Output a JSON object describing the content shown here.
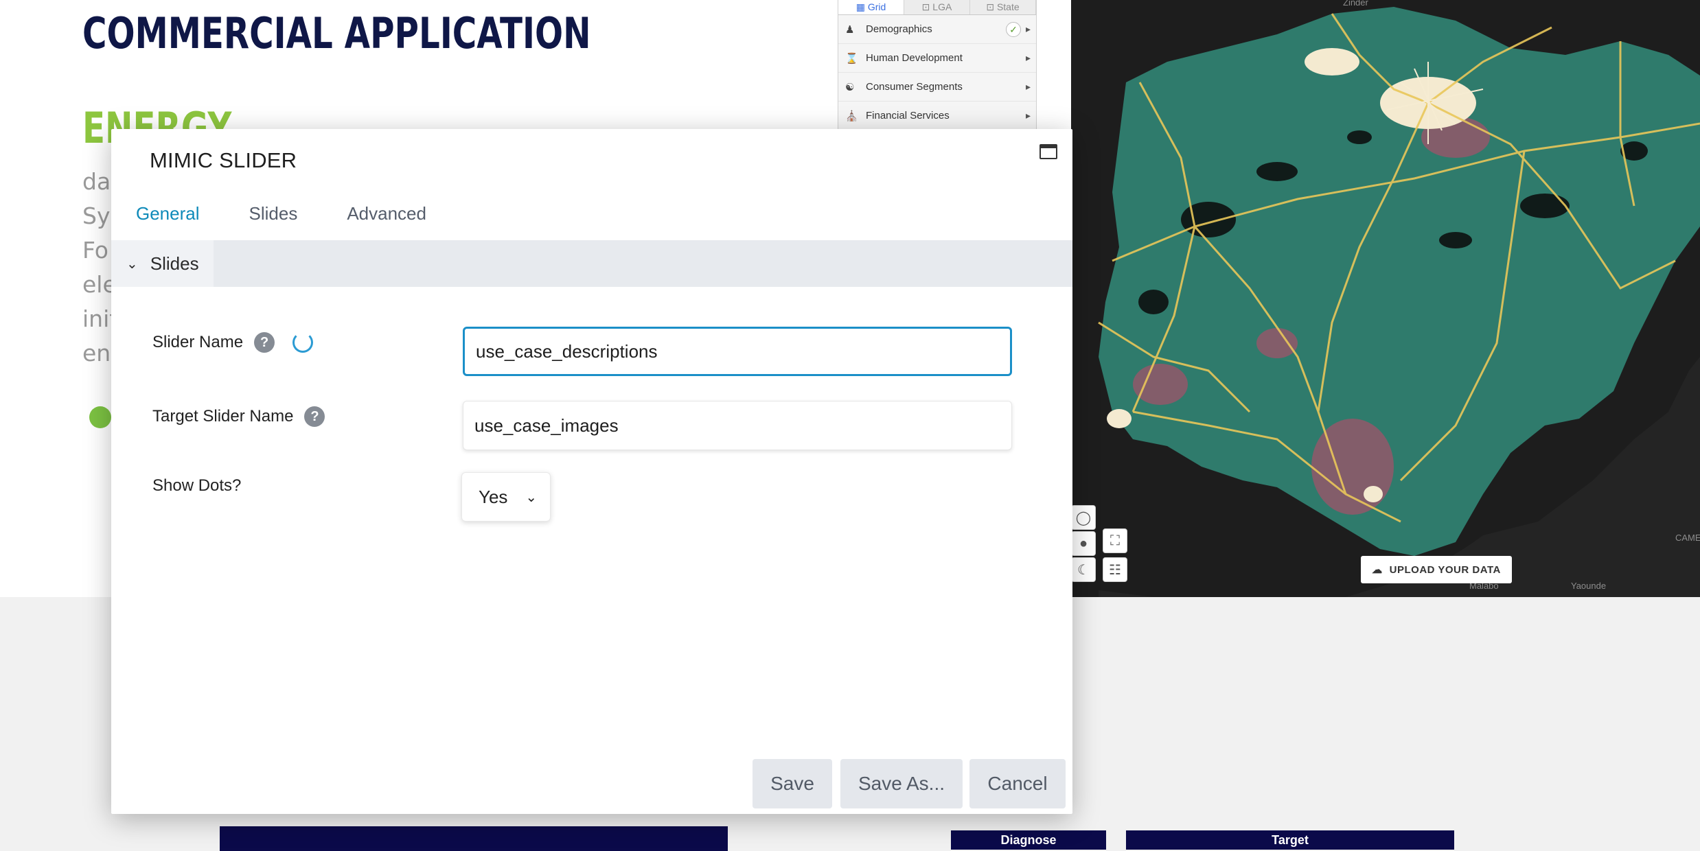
{
  "page": {
    "heading": "COMMERCIAL APPLICATION",
    "subheading": "ENERGY",
    "paragraph_fragments": [
      "da",
      "Sys",
      "Fo",
      "ele",
      "init",
      "en"
    ]
  },
  "map": {
    "layer_tabs": [
      "Grid",
      "LGA",
      "State"
    ],
    "layers": [
      "Demographics",
      "Human Development",
      "Consumer Segments",
      "Financial Services"
    ],
    "upload_label": "UPLOAD YOUR DATA",
    "place_labels": [
      "Zinder",
      "Malabo",
      "Yaounde",
      "CAME"
    ],
    "colors": {
      "land": "#2f7b6c",
      "background": "#1c1c1c",
      "roads": "#e9c75a",
      "urban": "#f2e6c8",
      "hotspots": "#c8466a"
    }
  },
  "modal": {
    "title": "MIMIC SLIDER",
    "tabs": [
      "General",
      "Slides",
      "Advanced"
    ],
    "active_tab": "General",
    "section_label": "Slides",
    "fields": {
      "slider_name_label": "Slider Name",
      "slider_name_value": "use_case_descriptions",
      "target_slider_name_label": "Target Slider Name",
      "target_slider_name_value": "use_case_images",
      "show_dots_label": "Show Dots?",
      "show_dots_value": "Yes"
    },
    "buttons": {
      "save": "Save",
      "save_as": "Save As...",
      "cancel": "Cancel"
    }
  },
  "bottom": {
    "diagnose_label": "Diagnose",
    "target_label": "Target"
  },
  "colors": {
    "accent": "#0e8ab9",
    "heading": "#0f1747",
    "energy_green": "#8dc63f",
    "navy": "#0b0a4a"
  }
}
